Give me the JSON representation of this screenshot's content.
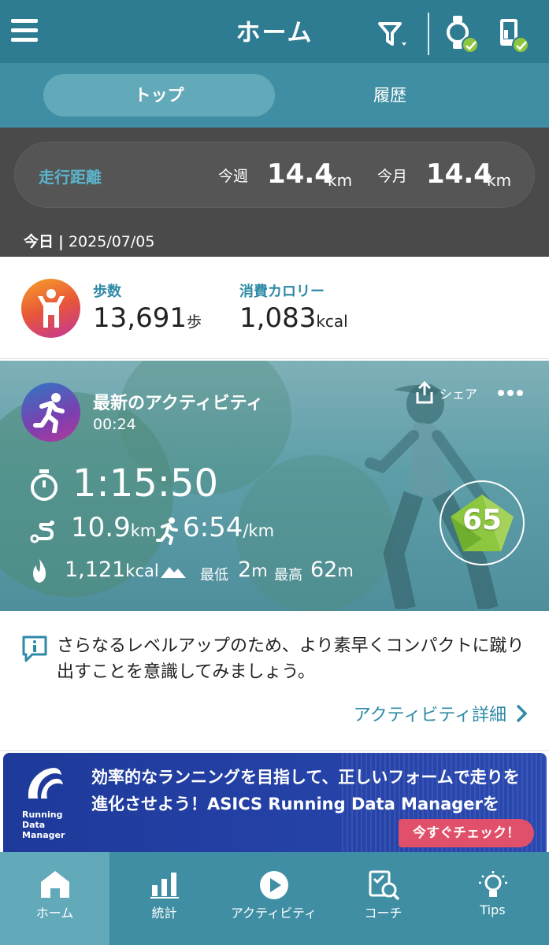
{
  "header": {
    "title": "ホーム",
    "menu_icon": "hamburger-icon",
    "filter_icon": "filter-icon",
    "watch_icon": "watch-connected-icon",
    "phone_icon": "phone-connected-icon"
  },
  "tabs": [
    {
      "label": "トップ",
      "active": true
    },
    {
      "label": "履歴",
      "active": false
    }
  ],
  "distance": {
    "label": "走行距離",
    "week_label": "今週",
    "week_value": "14.4",
    "week_unit": "km",
    "month_label": "今月",
    "month_value": "14.4",
    "month_unit": "km"
  },
  "today": {
    "label": "今日",
    "separator": "|",
    "date": "2025/07/05"
  },
  "daily": {
    "steps_label": "歩数",
    "steps_value": "13,691",
    "steps_unit": "歩",
    "calories_label": "消費カロリー",
    "calories_value": "1,083",
    "calories_unit": "kcal"
  },
  "activity": {
    "title": "最新のアクティビティ",
    "time": "00:24",
    "share_label": "シェア",
    "duration": "1:15:50",
    "distance_value": "10.9",
    "distance_unit": "km",
    "pace_value": "6:54",
    "pace_unit": "/km",
    "calories_value": "1,121",
    "calories_unit": "kcal",
    "elev_min_label": "最低",
    "elev_min_value": "2",
    "elev_min_unit": "m",
    "elev_max_label": "最高",
    "elev_max_value": "62",
    "elev_max_unit": "m",
    "score": "65"
  },
  "advice": {
    "text": "さらなるレベルアップのため、より素早くコンパクトに蹴り出すことを意識してみましょう。",
    "link_label": "アクティビティ詳細"
  },
  "banner": {
    "logo_text_1": "Running",
    "logo_text_2": "Data",
    "logo_text_3": "Manager",
    "text": "効率的なランニングを目指して、正しいフォームで走りを進化させよう！ASICS Running Data Managerを",
    "cta": "今すぐチェック！"
  },
  "nav": [
    {
      "label": "ホーム",
      "icon": "home-icon",
      "active": true
    },
    {
      "label": "統計",
      "icon": "bar-chart-icon",
      "active": false
    },
    {
      "label": "アクティビティ",
      "icon": "play-icon",
      "active": false
    },
    {
      "label": "コーチ",
      "icon": "coach-icon",
      "active": false
    },
    {
      "label": "Tips",
      "icon": "lightbulb-icon",
      "active": false
    }
  ],
  "colors": {
    "header": "#2e7c92",
    "tabbar": "#3f8ea3",
    "accent": "#2e8aa6",
    "check": "#8dc63f",
    "score_fill": "#8dc63f"
  }
}
